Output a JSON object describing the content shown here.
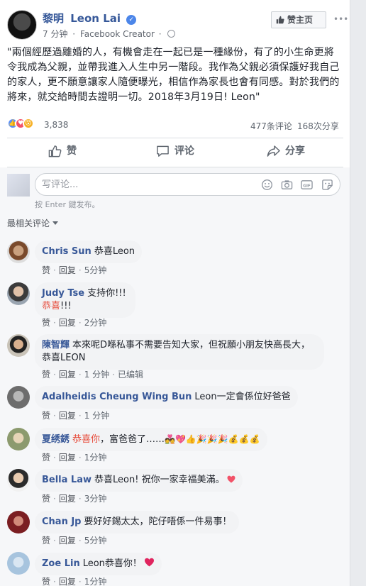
{
  "post": {
    "author_cn": "黎明",
    "author_en": "Leon Lai",
    "verified_mark": "✓",
    "time": "7 分钟",
    "sep": "·",
    "source": "Facebook Creator",
    "like_page_label": "赞主页",
    "more": "•••",
    "text": "\"兩個經歷過離婚的人，有機會走在一起已是一種緣份，有了的小生命更將令我成為父親，並帶我進入人生中另一階段。我作為父親必須保護好我自己的家人，更不願意讓家人隨便曝光，相信作為家長也會有同感。對於我們的將來，就交給時間去證明一切。2018年3月19日! Leon\"",
    "reactions_count": "3,838",
    "comments_count": "477条评论",
    "shares_count": "168次分享"
  },
  "actions": {
    "like": "赞",
    "comment": "评论",
    "share": "分享"
  },
  "compose": {
    "placeholder": "写评论...",
    "hint": "按 Enter 鍵发布。"
  },
  "sort_label": "最相关评论",
  "comment_actions": {
    "like": "赞",
    "reply": "回复",
    "edited": "已编辑"
  },
  "comments": [
    {
      "author": "Chris Sun",
      "text": "恭喜Leon",
      "time": "5分钟"
    },
    {
      "author": "Judy Tse",
      "text": "支持你!!!",
      "text2_red": "恭喜",
      "text2_tail": "!!!",
      "time": "2分钟"
    },
    {
      "author": "陳智輝",
      "text": "本來呢D喺私事不需要告知大家，但祝願小朋友快高長大，恭喜LEON",
      "time": "1 分钟"
    },
    {
      "author": "Adalheidis Cheung Wing Bun",
      "text": "Leon一定會係位好爸爸",
      "time": "1 分钟"
    },
    {
      "author": "夏绣銹",
      "text_red": "恭喜你",
      "text": "，富爸爸了……",
      "emoji": "💑💖👍🎉🎉🎉💰💰💰",
      "time": "1分钟"
    },
    {
      "author": "Bella Law",
      "text": "恭喜Leon! 祝你一家幸福美滿。",
      "time": "3分钟"
    },
    {
      "author": "Chan Jp",
      "text": "要好好錫太太，陀仔唔係一件易事！",
      "time": "5分钟"
    },
    {
      "author": "Zoe Lin",
      "text": "Leon恭喜你！",
      "time": "1分钟"
    }
  ],
  "colors": {
    "link_blue": "#385898",
    "like_blue": "#5890ff",
    "love_red": "#f25268",
    "wow_yellow": "#f7b125",
    "highlight_red": "#e74c3c"
  }
}
